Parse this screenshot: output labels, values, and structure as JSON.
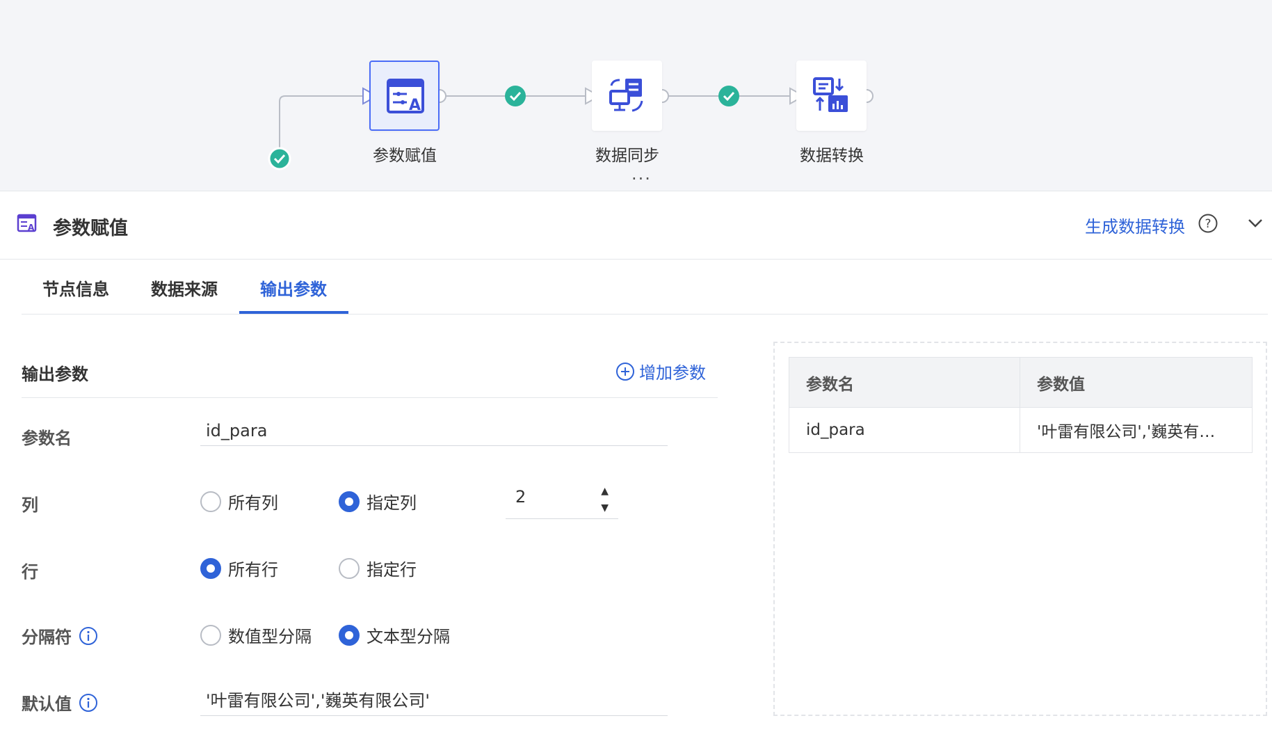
{
  "flow": {
    "nodes": [
      {
        "label": "参数赋值",
        "icon": "param-assign-icon",
        "selected": true
      },
      {
        "label": "数据同步",
        "icon": "data-sync-icon",
        "selected": false
      },
      {
        "label": "数据转换",
        "icon": "data-transform-icon",
        "selected": false
      }
    ],
    "handle": "···"
  },
  "panel": {
    "title": "参数赋值",
    "generate_link": "生成数据转换"
  },
  "tabs": [
    {
      "label": "节点信息",
      "active": false
    },
    {
      "label": "数据来源",
      "active": false
    },
    {
      "label": "输出参数",
      "active": true
    }
  ],
  "form": {
    "section_title": "输出参数",
    "add_param": "增加参数",
    "param_name": {
      "label": "参数名",
      "value": "id_para"
    },
    "column": {
      "label": "列",
      "options": [
        "所有列",
        "指定列"
      ],
      "selected": "指定列",
      "stepper_value": "2"
    },
    "row": {
      "label": "行",
      "options": [
        "所有行",
        "指定行"
      ],
      "selected": "所有行"
    },
    "separator": {
      "label": "分隔符",
      "options": [
        "数值型分隔",
        "文本型分隔"
      ],
      "selected": "文本型分隔"
    },
    "default_value": {
      "label": "默认值",
      "value": "'叶雷有限公司','巍英有限公司'"
    }
  },
  "preview": {
    "headers": [
      "参数名",
      "参数值"
    ],
    "rows": [
      [
        "id_para",
        "'叶雷有限公司','巍英有…"
      ]
    ]
  },
  "colors": {
    "accent": "#2f63d8",
    "check": "#2bb39a",
    "node_icon": "#3b4fd8",
    "panel_icon": "#5b3fd0"
  }
}
